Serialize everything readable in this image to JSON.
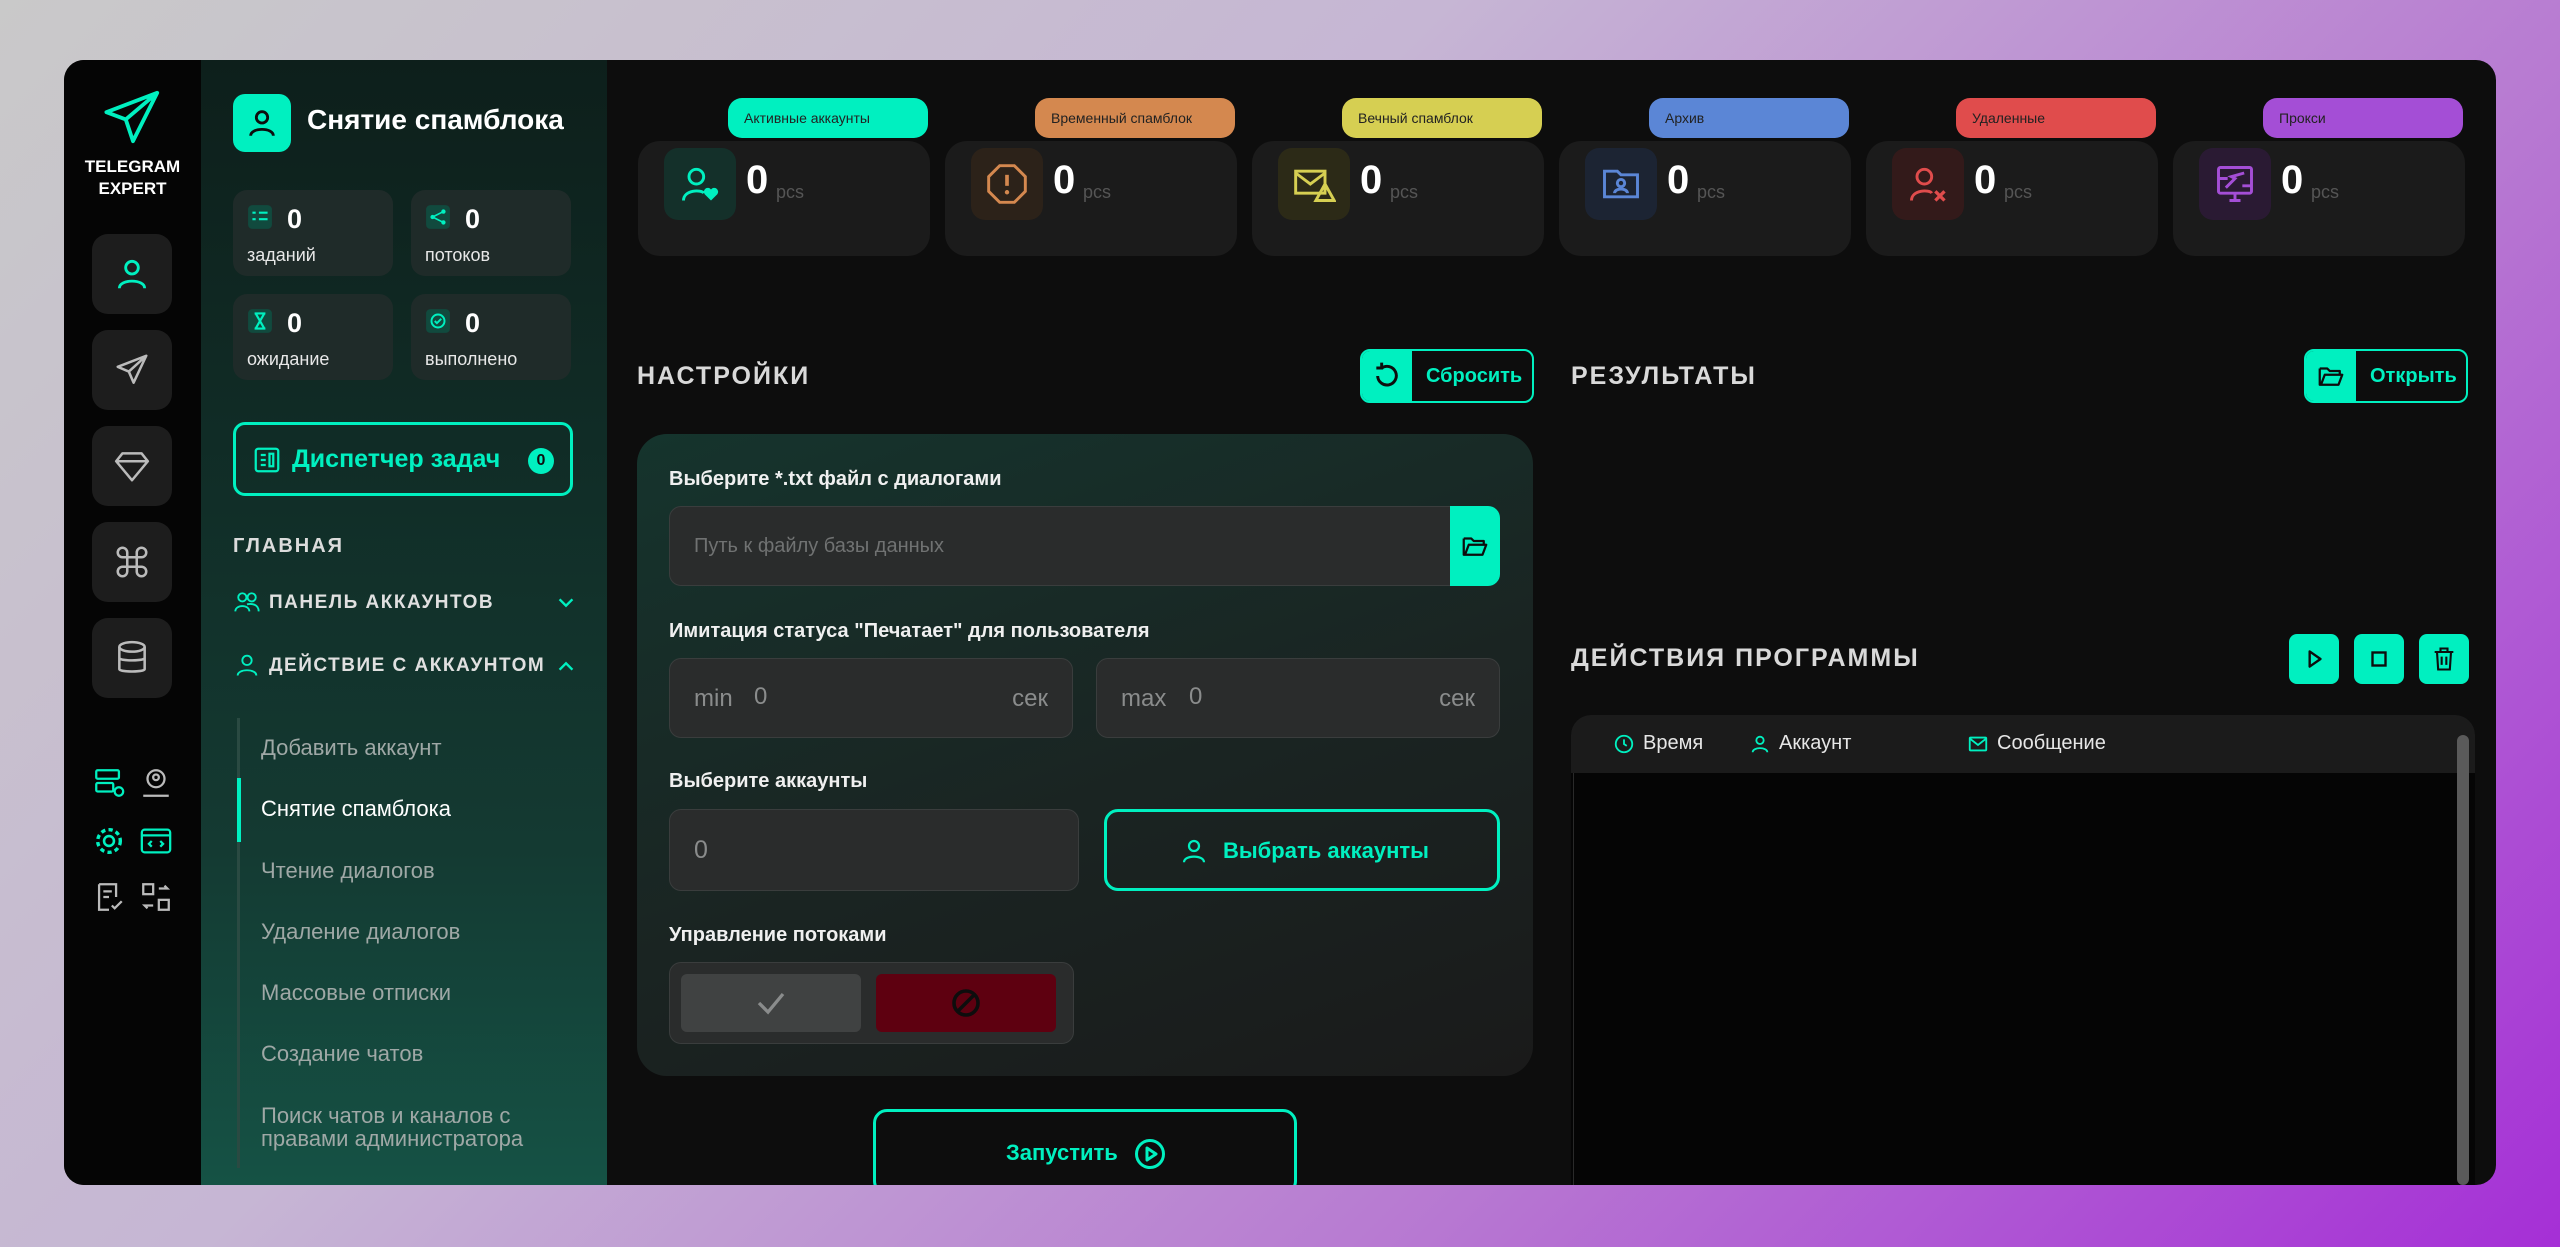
{
  "brand": {
    "line1": "TELEGRAM",
    "line2": "EXPERT"
  },
  "sidebar": {
    "page_title": "Снятие спамблока",
    "stats": [
      {
        "value": "0",
        "label": "заданий"
      },
      {
        "value": "0",
        "label": "потоков"
      },
      {
        "value": "0",
        "label": "ожидание"
      },
      {
        "value": "0",
        "label": "выполнено"
      }
    ],
    "dispatcher": {
      "label": "Диспетчер задач",
      "count": "0"
    },
    "main_heading": "ГЛАВНАЯ",
    "accounts_panel": "ПАНЕЛЬ АККАУНТОВ",
    "account_actions": "ДЕЙСТВИЕ С АККАУНТОМ",
    "items": [
      {
        "label": "Добавить аккаунт"
      },
      {
        "label": "Снятие спамблока"
      },
      {
        "label": "Чтение диалогов"
      },
      {
        "label": "Удаление диалогов"
      },
      {
        "label": "Массовые отписки"
      },
      {
        "label": "Создание чатов"
      },
      {
        "label": "Поиск чатов и каналов с"
      },
      {
        "label": "правами администратора"
      }
    ]
  },
  "cards": [
    {
      "tag": "Активные аккаунты",
      "value": "0",
      "unit": "pcs",
      "color": "#00f0c0",
      "icon": "user-heart-icon"
    },
    {
      "tag": "Временный спамблок",
      "value": "0",
      "unit": "pcs",
      "color": "#d4884f",
      "icon": "alert-octagon-icon"
    },
    {
      "tag": "Вечный спамблок",
      "value": "0",
      "unit": "pcs",
      "color": "#d6cf52",
      "icon": "mail-warning-icon"
    },
    {
      "tag": "Архив",
      "value": "0",
      "unit": "pcs",
      "color": "#5b86d6",
      "icon": "folder-user-icon"
    },
    {
      "tag": "Удаленные",
      "value": "0",
      "unit": "pcs",
      "color": "#e04c4c",
      "icon": "user-remove-icon"
    },
    {
      "tag": "Прокси",
      "value": "0",
      "unit": "pcs",
      "color": "#a44ed6",
      "icon": "proxy-icon"
    }
  ],
  "settings": {
    "title": "НАСТРОЙКИ",
    "reset_label": "Сбросить",
    "file_label": "Выберите *.txt файл с диалогами",
    "file_placeholder": "Путь к файлу базы данных",
    "typing_label": "Имитация статуса \"Печатает\" для пользователя",
    "min_label": "min",
    "min_value": "0",
    "max_label": "max",
    "max_value": "0",
    "unit": "сек",
    "accounts_label": "Выберите аккаунты",
    "accounts_value": "0",
    "select_accounts": "Выбрать аккаунты",
    "threads_label": "Управление потоками",
    "run_label": "Запустить"
  },
  "results": {
    "title": "РЕЗУЛЬТАТЫ",
    "open_label": "Открыть"
  },
  "actions": {
    "title": "ДЕЙСТВИЯ ПРОГРАММЫ",
    "columns": [
      "Время",
      "Аккаунт",
      "Сообщение"
    ]
  }
}
